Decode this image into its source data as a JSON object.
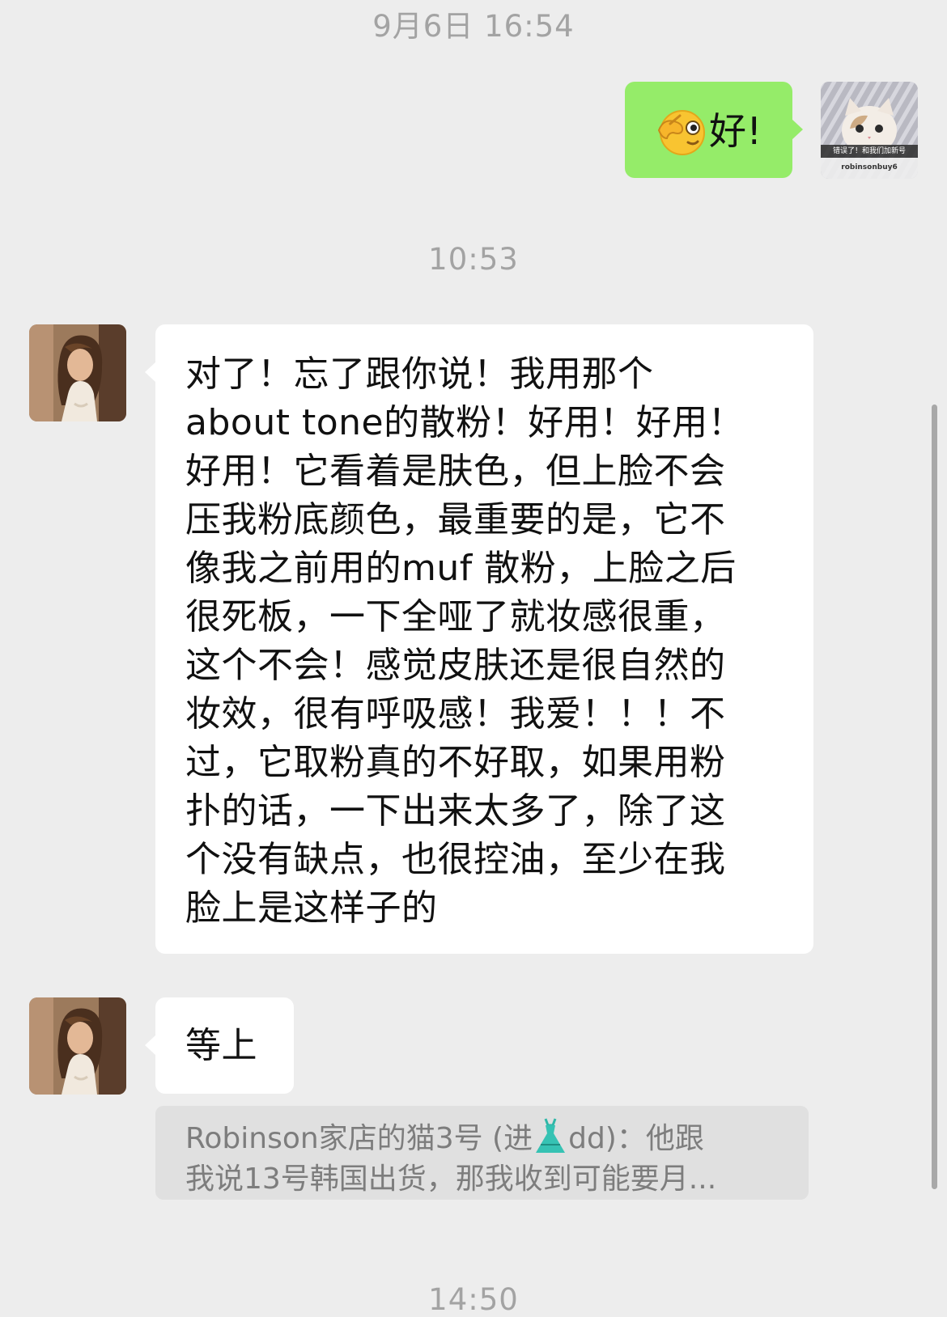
{
  "timestamps": {
    "first": "9月6日 16:54",
    "second": "10:53",
    "third": "14:50"
  },
  "outgoing": {
    "text": "好!",
    "emoji": "pointing-at-self-face-emoji",
    "sticker": {
      "caption": "错误了！和我们加新号",
      "watermark": "robinsonbuy6"
    }
  },
  "incoming": {
    "long_message": "对了！忘了跟你说！我用那个\nabout tone的散粉！好用！好用！\n好用！它看着是肤色，但上脸不会\n压我粉底颜色，最重要的是，它不\n像我之前用的muf 散粉，上脸之后\n很死板，一下全哑了就妆感很重，\n这个不会！感觉皮肤还是很自然的\n妆效，很有呼吸感！我爱！！！不\n过，它取粉真的不好取，如果用粉\n扑的话，一下出来太多了，除了这\n个没有缺点，也很控油，至少在我\n脸上是这样子的",
    "short_message": "等上"
  },
  "quote": {
    "line1_before_emoji": "Robinson家店的猫3号 (进",
    "emoji": "dress-emoji",
    "line1_after_emoji": "dd)：他跟",
    "line2": "我说13号韩国出货，那我收到可能要月..."
  },
  "colors": {
    "background": "#ededed",
    "outgoing_bubble": "#95ec69",
    "incoming_bubble": "#ffffff",
    "timestamp": "#a3a3a3",
    "quote_bg": "#e0e0e0"
  }
}
